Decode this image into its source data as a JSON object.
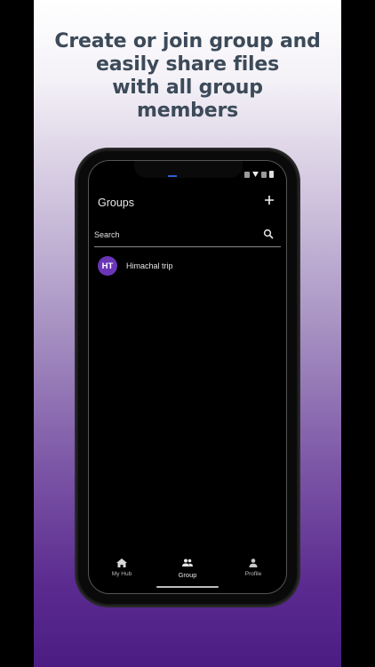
{
  "promo": {
    "headline": "Create or join group and\neasily share files\nwith all group\nmembers"
  },
  "app": {
    "title": "Groups",
    "add_icon": "plus-icon",
    "search": {
      "placeholder": "Search",
      "icon": "search-icon"
    },
    "groups": [
      {
        "initials": "HT",
        "name": "Himachal trip"
      }
    ],
    "bottom_nav": [
      {
        "label": "My Hub",
        "icon": "home-icon",
        "active": false
      },
      {
        "label": "Group",
        "icon": "group-icon",
        "active": true
      },
      {
        "label": "Profile",
        "icon": "person-icon",
        "active": false
      }
    ]
  },
  "colors": {
    "accent": "#6a35b7",
    "gradient_bottom": "#4b1d83",
    "headline": "#3c4a59"
  }
}
